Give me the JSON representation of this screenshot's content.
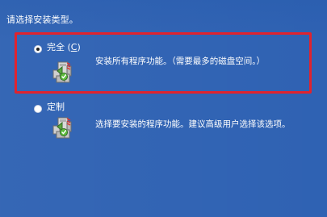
{
  "header": {
    "prompt": "请选择安装类型。"
  },
  "options": [
    {
      "label_main": "完全",
      "label_key": "(",
      "label_key_letter": "C",
      "label_key_close": ")",
      "description": "安装所有程序功能。（需要最多的磁盘空间。）",
      "selected": true,
      "icon": "package-icon"
    },
    {
      "label_main": "定制",
      "label_key": "",
      "label_key_letter": "",
      "label_key_close": "",
      "description": "选择要安装的程序功能。建议高级用户选择该选项。",
      "selected": false,
      "icon": "package-icon"
    }
  ],
  "colors": {
    "background": "#2f62b3",
    "highlight": "#e0232e",
    "text": "#ffffff"
  }
}
